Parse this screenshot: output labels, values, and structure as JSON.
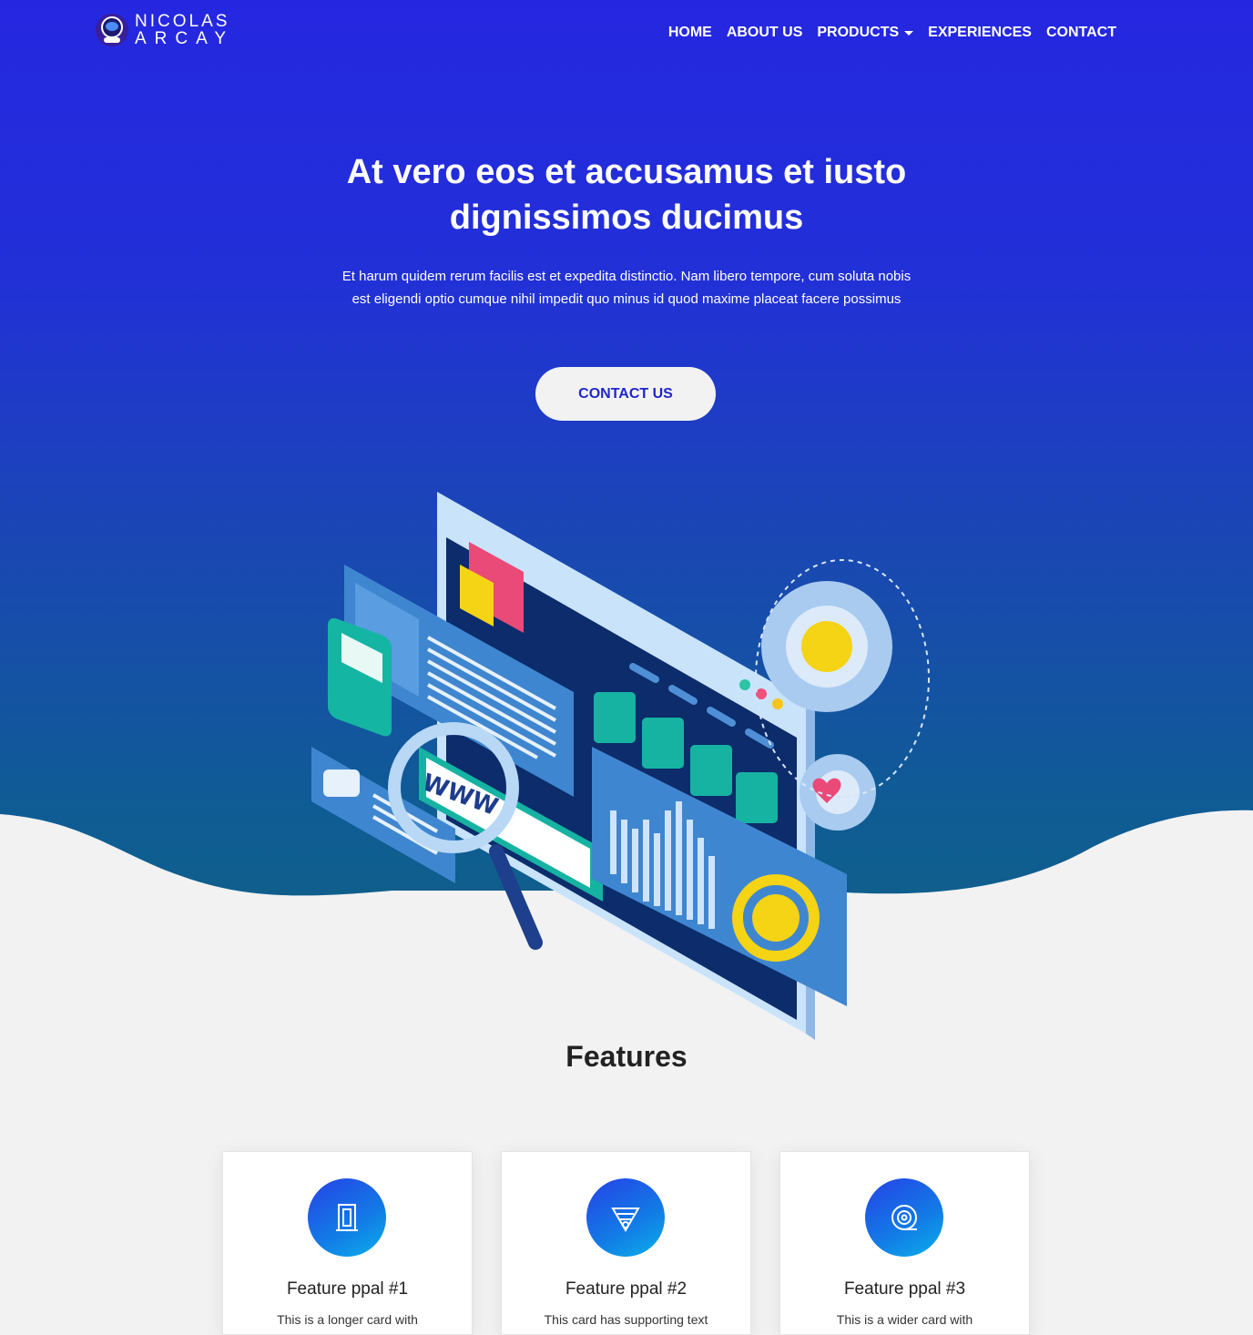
{
  "brand": {
    "line1": "NICOLAS",
    "line2": "ARCAY"
  },
  "nav": {
    "items": [
      "HOME",
      "ABOUT US",
      "PRODUCTS",
      "EXPERIENCES",
      "CONTACT"
    ]
  },
  "hero": {
    "title": "At vero eos et accusamus et iusto dignissimos ducimus",
    "subtitle": "Et harum quidem rerum facilis est et expedita distinctio. Nam libero tempore, cum soluta nobis est eligendi optio cumque nihil impedit quo minus id quod maxime placeat facere possimus",
    "cta": "CONTACT US",
    "illustration_text": "WWW"
  },
  "features": {
    "title": "Features",
    "cards": [
      {
        "title": "Feature ppal #1",
        "text": "This is a longer card with",
        "icon": "door-icon"
      },
      {
        "title": "Feature ppal #2",
        "text": "This card has supporting text",
        "icon": "fan-icon"
      },
      {
        "title": "Feature ppal #3",
        "text": "This is a wider card with",
        "icon": "tape-icon"
      }
    ]
  },
  "colors": {
    "hero_top": "#2527e0",
    "hero_bottom": "#0f5f8c",
    "accent": "#2126c9",
    "background": "#f2f2f2"
  }
}
